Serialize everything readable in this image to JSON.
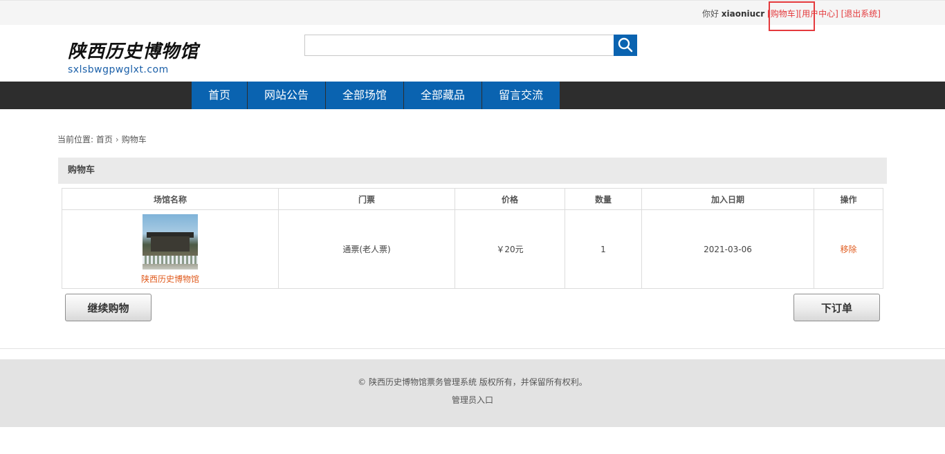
{
  "topbar": {
    "greeting": "你好",
    "username": "xiaoniucr",
    "cart_link": "[购物车]",
    "user_center_link": "[用户中心]",
    "logout_link": "[退出系统]"
  },
  "logo": {
    "cn": "陕西历史博物馆",
    "en": "sxlsbwgpwglxt.com"
  },
  "search": {
    "placeholder": "",
    "icon": "search-icon"
  },
  "nav": {
    "items": [
      {
        "label": "首页"
      },
      {
        "label": "网站公告"
      },
      {
        "label": "全部场馆"
      },
      {
        "label": "全部藏品"
      },
      {
        "label": "留言交流"
      }
    ]
  },
  "breadcrumb": {
    "prefix": "当前位置:",
    "home": "首页",
    "separator": "›",
    "current": "购物车"
  },
  "cart": {
    "title": "购物车",
    "headers": [
      "场馆名称",
      "门票",
      "价格",
      "数量",
      "加入日期",
      "操作"
    ],
    "rows": [
      {
        "venue": "陕西历史博物馆",
        "ticket": "通票(老人票)",
        "price": "￥20元",
        "quantity": "1",
        "date": "2021-03-06",
        "action": "移除"
      }
    ],
    "continue_label": "继续购物",
    "order_label": "下订单"
  },
  "footer": {
    "copyright": "© 陕西历史博物馆票务管理系统 版权所有，并保留所有权利。",
    "admin_link": "管理员入口"
  },
  "colors": {
    "brand_blue": "#0a63b0",
    "accent_red": "#e4393c",
    "link_orange": "#e05c1f"
  }
}
